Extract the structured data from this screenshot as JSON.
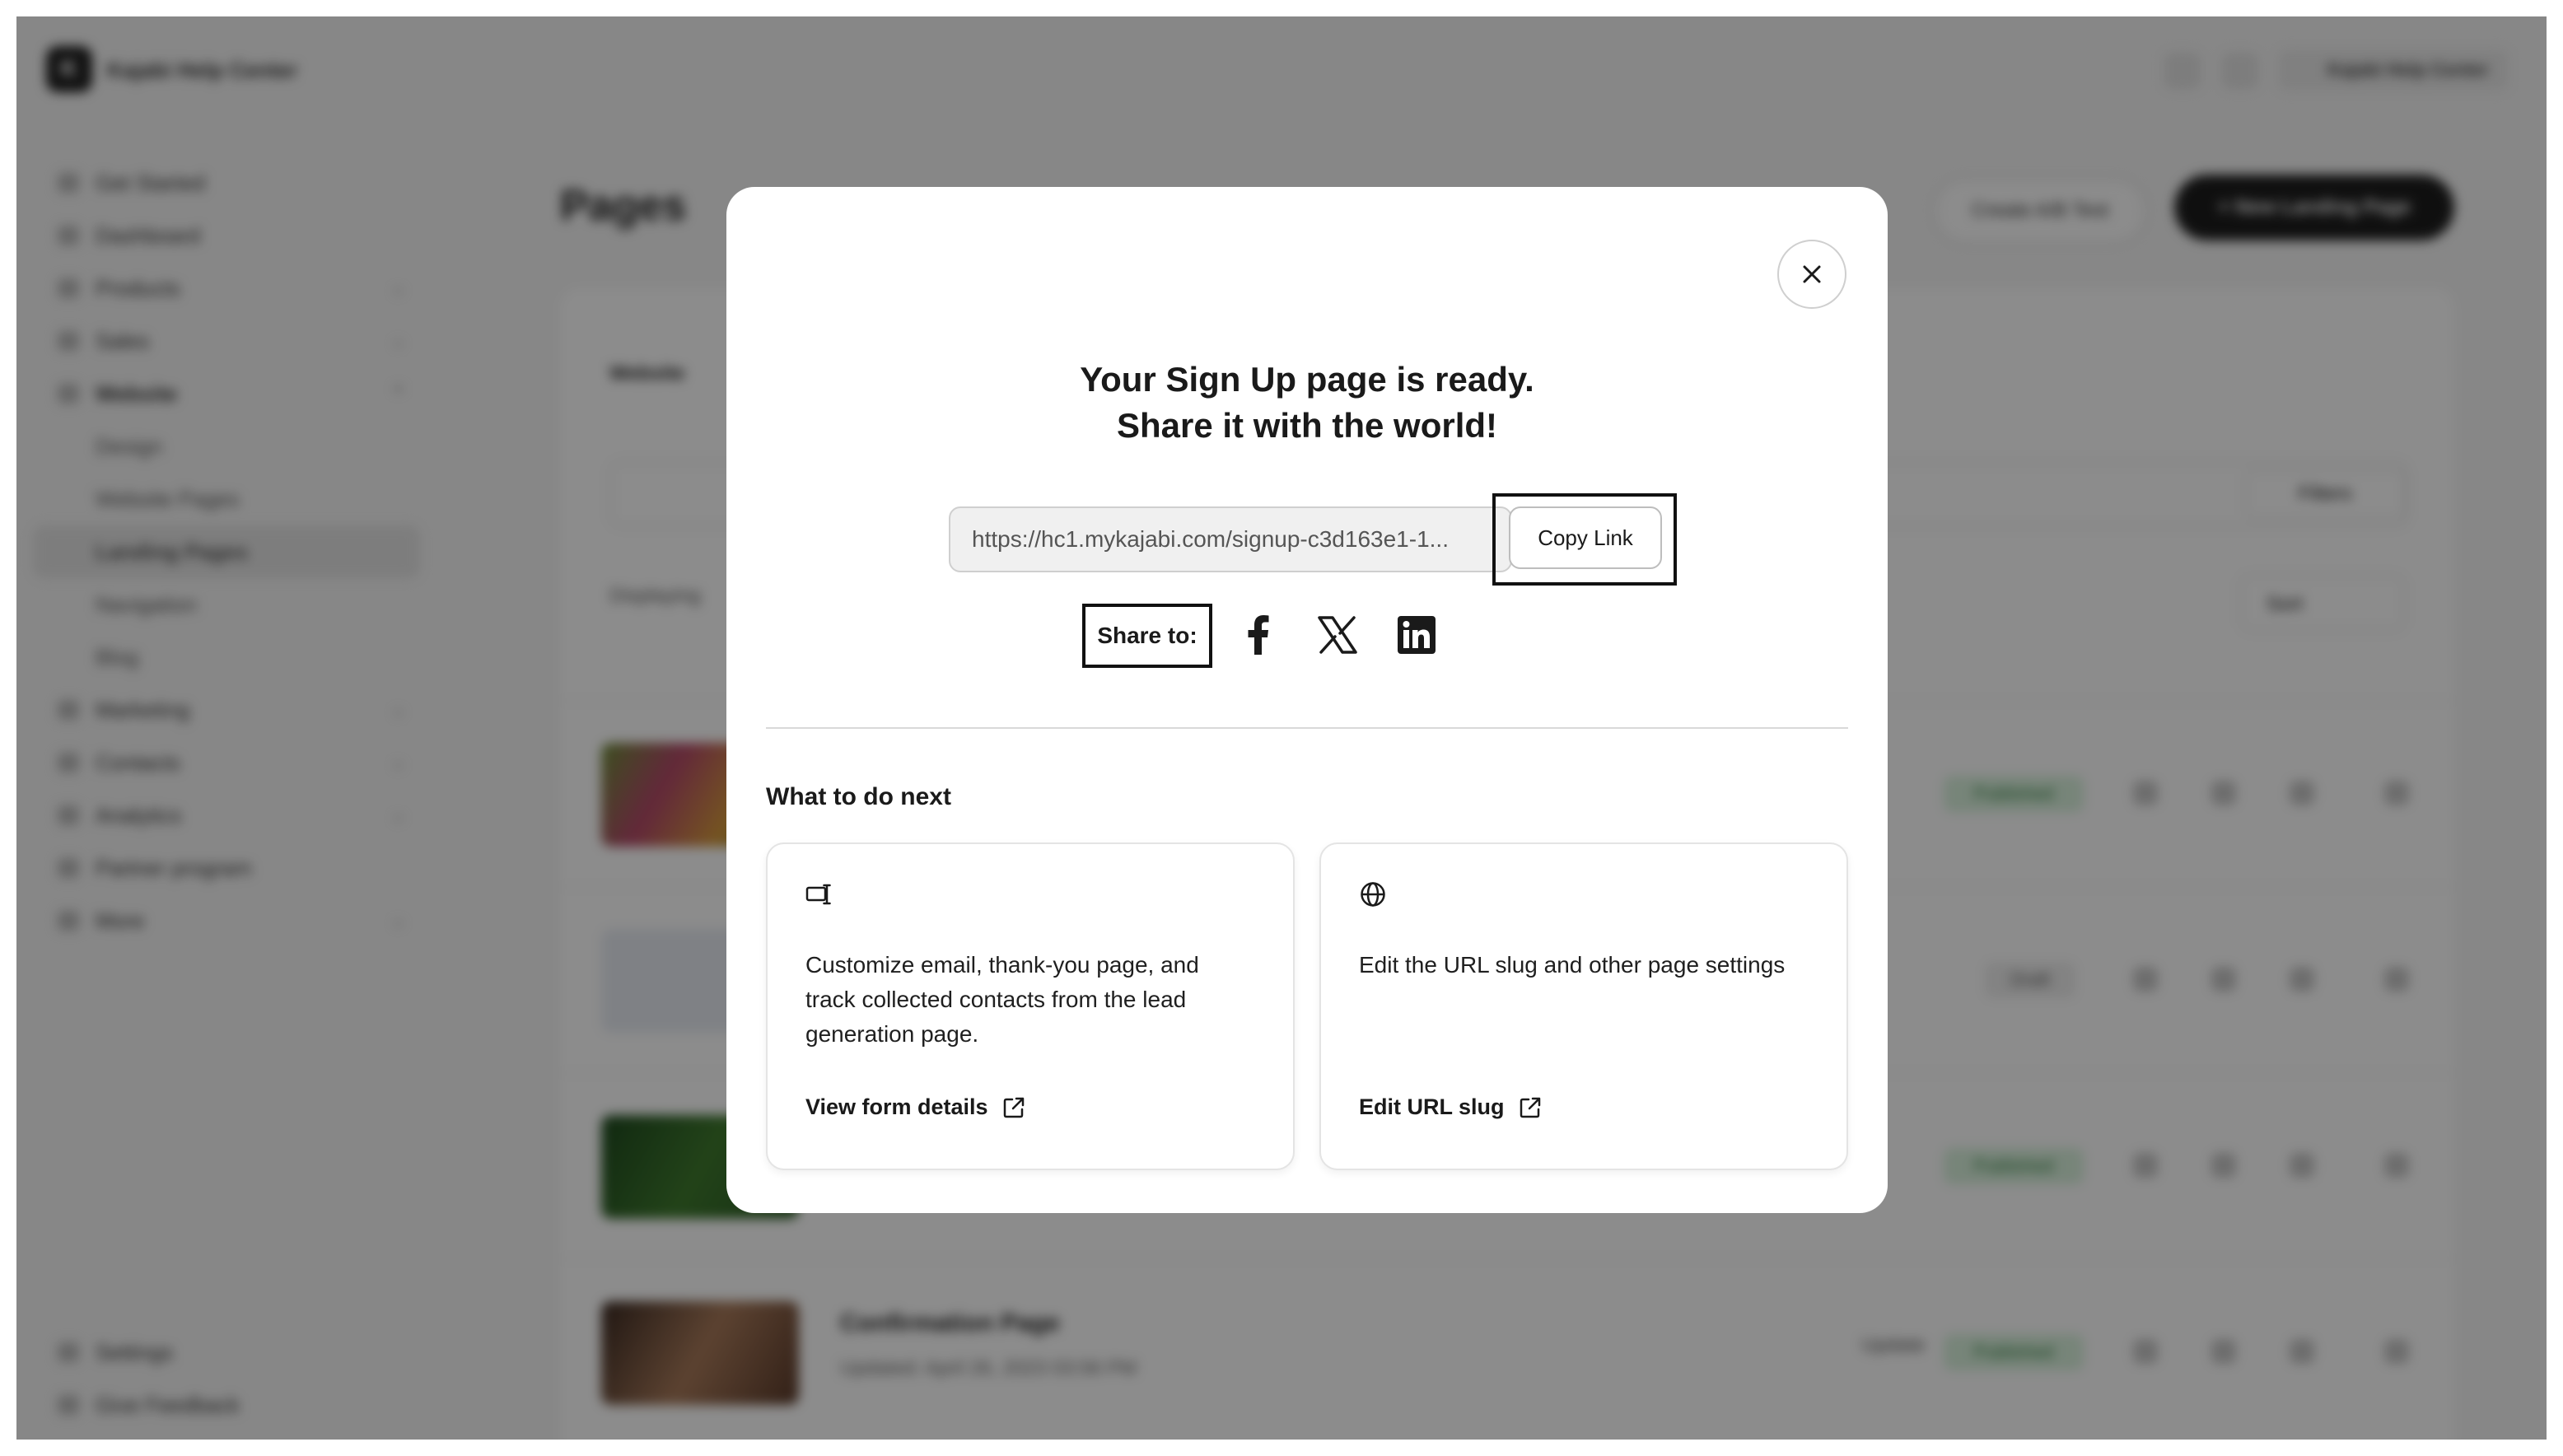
{
  "background": {
    "brand": "Kajabi Help Center",
    "user": "Kajabi Help Center",
    "sidebar": {
      "items": [
        {
          "label": "Get Started"
        },
        {
          "label": "Dashboard"
        },
        {
          "label": "Products"
        },
        {
          "label": "Sales"
        },
        {
          "label": "Website"
        },
        {
          "label": "Design"
        },
        {
          "label": "Website Pages"
        },
        {
          "label": "Landing Pages"
        },
        {
          "label": "Navigation"
        },
        {
          "label": "Blog"
        },
        {
          "label": "Marketing"
        },
        {
          "label": "Contacts"
        },
        {
          "label": "Analytics"
        },
        {
          "label": "Partner program"
        },
        {
          "label": "More"
        }
      ],
      "bottom": [
        {
          "label": "Settings"
        },
        {
          "label": "Give Feedback"
        }
      ]
    },
    "page_title": "Pages",
    "create_ab_label": "Create A/B Test",
    "new_page_label": "+ New Landing Page",
    "tab_label": "Website",
    "filters_label": "Filters",
    "displaying_label": "Displaying",
    "sort_label": "Sort",
    "rows": [
      {
        "status": "Published"
      },
      {
        "status": "Draft"
      },
      {
        "status": "Published"
      },
      {
        "title": "Confirmation Page",
        "updated": "Updated: April 26, 2023 03:56 PM",
        "update_label": "Update",
        "status": "Published"
      }
    ]
  },
  "modal": {
    "title_line1": "Your Sign Up page is ready.",
    "title_line2": "Share it with the world!",
    "url": "https://hc1.mykajabi.com/signup-c3d163e1-1...",
    "copy_label": "Copy Link",
    "share_label": "Share to:",
    "social": [
      "facebook-icon",
      "x-icon",
      "linkedin-icon"
    ],
    "next_heading": "What to do next",
    "cards": [
      {
        "icon": "form-icon",
        "text": "Customize email, thank-you page, and track collected contacts from the lead generation page.",
        "link": "View form details"
      },
      {
        "icon": "globe-icon",
        "text": "Edit the URL slug and other page settings",
        "link": "Edit URL slug"
      }
    ]
  }
}
